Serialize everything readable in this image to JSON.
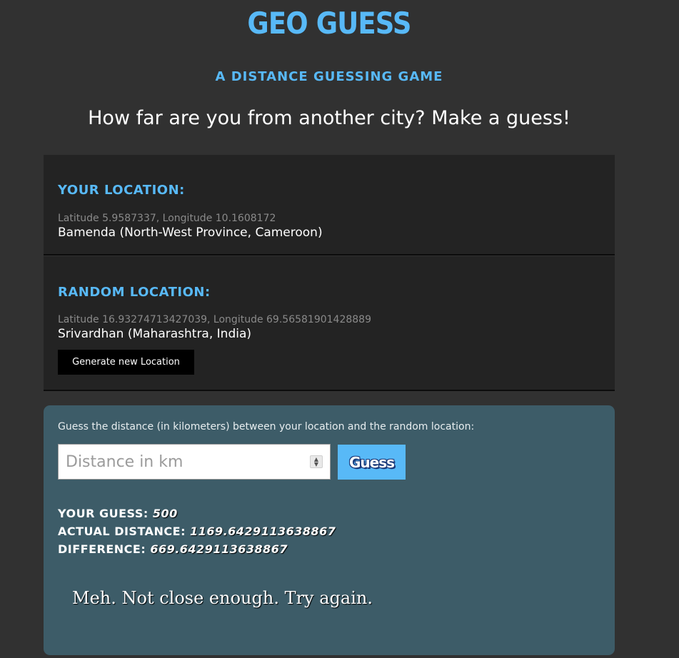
{
  "header": {
    "title": "GEO GUESS",
    "subtitle": "A DISTANCE GUESSING GAME",
    "tagline": "How far are you from another city? Make a guess!"
  },
  "your_location": {
    "heading": "YOUR LOCATION:",
    "coords": "Latitude 5.9587337, Longitude 10.1608172",
    "place": "Bamenda (North-West Province, Cameroon)"
  },
  "random_location": {
    "heading": "RANDOM LOCATION:",
    "coords": "Latitude 16.93274713427039, Longitude 69.56581901428889",
    "place": "Srivardhan (Maharashtra, India)",
    "generate_button": "Generate new Location"
  },
  "guess_form": {
    "prompt": "Guess the distance (in kilometers) between your location and the random location:",
    "input_placeholder": "Distance in km",
    "input_value": "",
    "button_label": "Guess"
  },
  "results": {
    "guess_label": "YOUR GUESS:",
    "guess_value": "500",
    "actual_label": "ACTUAL DISTANCE:",
    "actual_value": "1169.6429113638867",
    "difference_label": "DIFFERENCE:",
    "difference_value": "669.6429113638867",
    "verdict": "Meh. Not close enough. Try again."
  },
  "colors": {
    "accent": "#58b9f7",
    "background": "#313131",
    "panel": "#232323",
    "guess_panel": "#3d5c68"
  }
}
